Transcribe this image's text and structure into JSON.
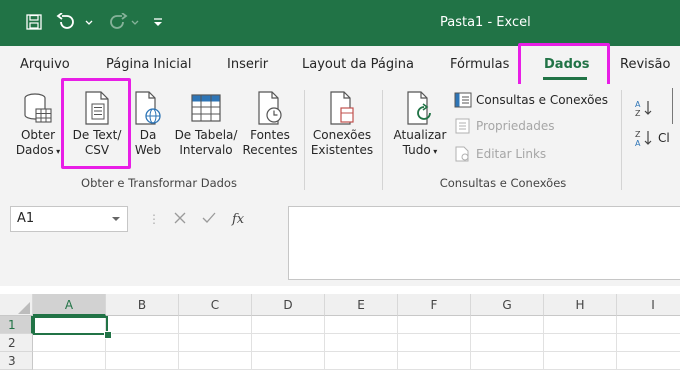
{
  "window": {
    "title": "Pasta1  -  Excel"
  },
  "colors": {
    "accent": "#217346",
    "highlight": "#e81ee6"
  },
  "quick_access": [
    {
      "name": "save-icon"
    },
    {
      "name": "undo-icon"
    },
    {
      "name": "redo-icon"
    },
    {
      "name": "customize-toolbar-icon"
    }
  ],
  "tabs": [
    {
      "id": "arquivo",
      "label": "Arquivo"
    },
    {
      "id": "pagina-inicial",
      "label": "Página Inicial"
    },
    {
      "id": "inserir",
      "label": "Inserir"
    },
    {
      "id": "layout",
      "label": "Layout da Página"
    },
    {
      "id": "formulas",
      "label": "Fórmulas"
    },
    {
      "id": "dados",
      "label": "Dados",
      "active": true
    },
    {
      "id": "revisao",
      "label": "Revisão"
    }
  ],
  "ribbon": {
    "obter": {
      "line1": "Obter",
      "line2": "Dados"
    },
    "text_csv": {
      "line1": "De Text/",
      "line2": "CSV"
    },
    "da_web": {
      "line1": "Da",
      "line2": "Web"
    },
    "tabela": {
      "line1": "De Tabela/",
      "line2": "Intervalo"
    },
    "fontes": {
      "line1": "Fontes",
      "line2": "Recentes"
    },
    "conexoes": {
      "line1": "Conexões",
      "line2": "Existentes"
    },
    "atualizar": {
      "line1": "Atualizar",
      "line2": "Tudo"
    },
    "consultas": "Consultas e Conexões",
    "propriedades": "Propriedades",
    "editar_links": "Editar Links",
    "group_obter": "Obter e Transformar Dados",
    "group_consultas": "Consultas e Conexões",
    "sort_label": "Cl"
  },
  "formula_bar": {
    "name_box": "A1",
    "fx": "fx",
    "value": ""
  },
  "grid": {
    "columns": [
      "A",
      "B",
      "C",
      "D",
      "E",
      "F",
      "G",
      "H",
      "I"
    ],
    "rows": [
      "1",
      "2",
      "3"
    ],
    "active_cell": "A1"
  }
}
